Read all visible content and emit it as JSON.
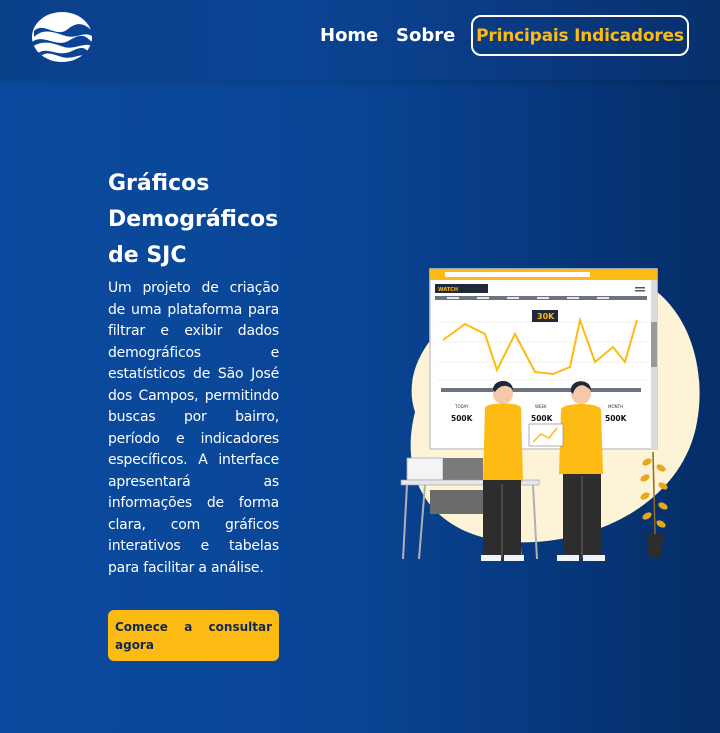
{
  "header": {
    "logo_name": "wave-logo",
    "nav": {
      "home": "Home",
      "sobre": "Sobre",
      "indicadores": "Principais Indicadores"
    }
  },
  "hero": {
    "title": "Gráficos Demográficos de SJC",
    "description": "Um projeto de criação de uma plataforma para filtrar e exibir dados demográficos e estatísticos de São José dos Campos, permitindo buscas por bairro, período e indicadores específicos. A interface apresentará as informações de forma clara, com gráficos interativos e tabelas para facilitar a análise.",
    "cta": "Comece a consultar agora"
  },
  "illustration": {
    "screen_tab": "WATCH",
    "highlight_value": "30K",
    "stats": [
      {
        "label": "TODAY",
        "value": "500K"
      },
      {
        "label": "WEEK",
        "value": "500K"
      },
      {
        "label": "MONTH",
        "value": "500K"
      }
    ],
    "colors": {
      "accent": "#fdba12",
      "background_blob": "#fdf3d6",
      "dark": "#1f2937"
    }
  }
}
